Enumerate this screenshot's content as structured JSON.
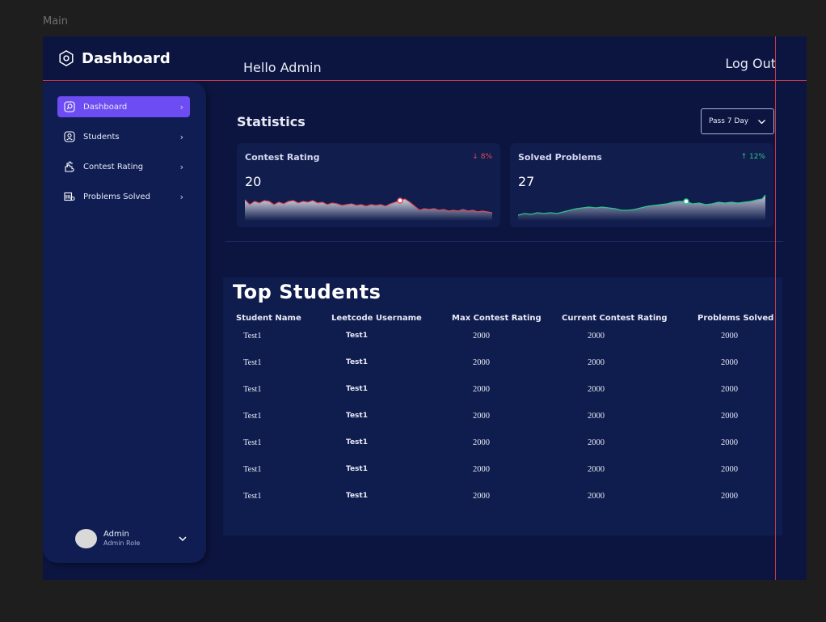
{
  "canvas_label": "Main",
  "app": {
    "logo_text": "Dashboard",
    "greeting": "Hello Admin",
    "logout_label": "Log Out"
  },
  "sidebar": {
    "items": [
      {
        "label": "Dashboard",
        "icon": "search-icon",
        "active": true
      },
      {
        "label": "Students",
        "icon": "user-icon",
        "active": false
      },
      {
        "label": "Contest Rating",
        "icon": "puzzle-icon",
        "active": false
      },
      {
        "label": "Problems Solved",
        "icon": "list-icon",
        "active": false
      }
    ],
    "user": {
      "name": "Admin",
      "role": "Admin Role"
    }
  },
  "statistics": {
    "title": "Statistics",
    "range_label": "Pass 7 Day",
    "cards": [
      {
        "title": "Contest Rating",
        "value": "20",
        "change": "8%",
        "direction": "down",
        "color": "#e24a5a"
      },
      {
        "title": "Solved Problems",
        "value": "27",
        "change": "12%",
        "direction": "up",
        "color": "#2ec48a"
      }
    ]
  },
  "top_students": {
    "title": "Top Students",
    "columns": [
      "Student Name",
      "Leetcode Username",
      "Max Contest Rating",
      "Current Contest Rating",
      "Problems Solved"
    ],
    "rows": [
      [
        "Test1",
        "Test1",
        "2000",
        "2000",
        "2000"
      ],
      [
        "Test1",
        "Test1",
        "2000",
        "2000",
        "2000"
      ],
      [
        "Test1",
        "Test1",
        "2000",
        "2000",
        "2000"
      ],
      [
        "Test1",
        "Test1",
        "2000",
        "2000",
        "2000"
      ],
      [
        "Test1",
        "Test1",
        "2000",
        "2000",
        "2000"
      ],
      [
        "Test1",
        "Test1",
        "2000",
        "2000",
        "2000"
      ],
      [
        "Test1",
        "Test1",
        "2000",
        "2000",
        "2000"
      ]
    ]
  },
  "colors": {
    "accent": "#6d4cf3",
    "guide_line": "#c43a4a",
    "background": "#0c1540",
    "negative": "#e24a5a",
    "positive": "#2ec48a"
  }
}
